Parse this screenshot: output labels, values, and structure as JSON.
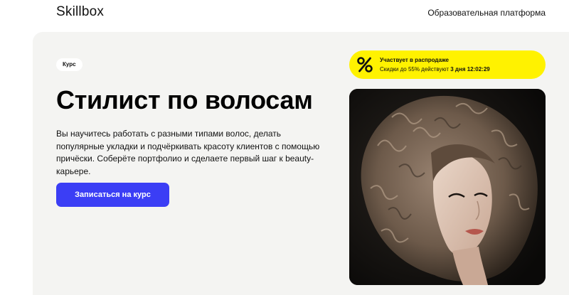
{
  "header": {
    "logo": "Skillbox",
    "nav_link": "Образовательная платформа"
  },
  "hero": {
    "badge": "Курс",
    "title": "Стилист по волосам",
    "description": "Вы научитесь работать с разными типами волос, делать популярные укладки и подчёркивать красоту клиентов с помощью причёски. Соберёте портфолио и сделаете первый шаг к beauty-карьере.",
    "cta_label": "Записаться на курс"
  },
  "sale": {
    "icon": "percent-icon",
    "title": "Участвует в распродаже",
    "text_prefix": "Скидки до 55% действуют",
    "days": "3 дня",
    "timer": "12:02:29"
  },
  "colors": {
    "accent": "#3b3ef5",
    "sale_yellow": "#fff200",
    "hero_bg": "#f4f4f2"
  }
}
